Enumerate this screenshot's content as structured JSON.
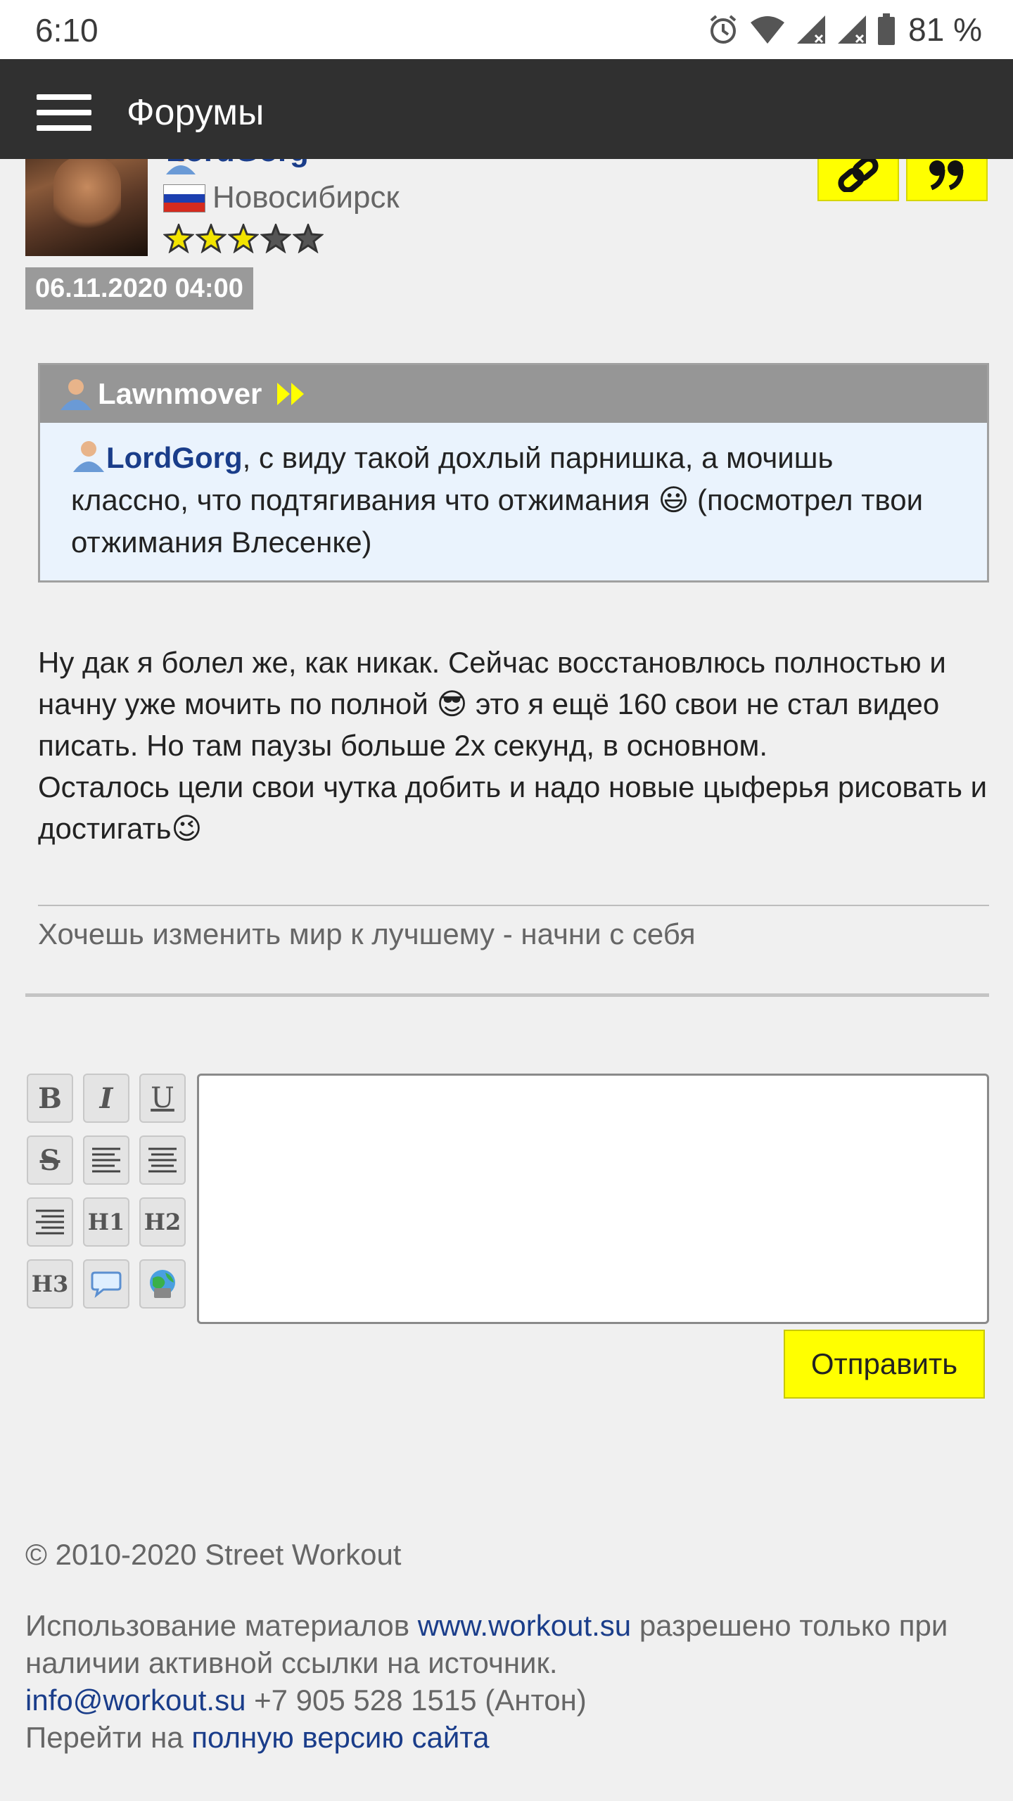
{
  "status_bar": {
    "time": "6:10",
    "battery": "81 %",
    "icons": [
      "alarm-icon",
      "wifi-icon",
      "signal-icon",
      "signal-icon",
      "battery-icon"
    ]
  },
  "app_bar": {
    "title": "Форумы",
    "menu_icon": "hamburger-menu-icon"
  },
  "post": {
    "author": "LordGorg",
    "city": "Новосибирск",
    "flag": "russia-flag",
    "rating": {
      "filled": 3,
      "total": 5
    },
    "date": "06.11.2020 04:00",
    "actions": [
      "link-icon",
      "quote-icon"
    ],
    "quote": {
      "author": "Lawnmover",
      "mention": "LordGorg",
      "text_1": ", с виду такой дохлый парнишка, а мочишь классно, что подтягивания что отжимания ",
      "emoji": "😃",
      "text_2": " (посмотрел твои отжимания Влесенке)"
    },
    "message": {
      "line_a": "Ну дак я болел же, как никак. Сейчас восстановлюсь полностью и начну уже мочить по полной ",
      "emoji_1": "😎",
      "line_b": " это я ещё 160 свои не стал видео писать. Но там паузы больше 2х секунд, в основном.",
      "line_c": "Осталось цели свои чутка добить и надо новые цыферья рисовать и достигать",
      "emoji_2": "😉"
    },
    "signature": "Хочешь изменить мир к лучшему - начни с себя"
  },
  "editor": {
    "buttons": [
      "B",
      "I",
      "U",
      "S",
      "align-left",
      "align-center",
      "align-right",
      "H1",
      "H2",
      "H3",
      "speech-bubble-icon",
      "globe-image-icon"
    ],
    "send_label": "Отправить",
    "value": ""
  },
  "footer": {
    "copyright": "© 2010-2020 Street Workout",
    "usage_pre": "Использование материалов ",
    "site_link": "www.workout.su",
    "usage_post": " разрешено только при наличии активной ссылки на источник.",
    "email": "info@workout.su",
    "phone": " +7 905 528 1515 (Антон)",
    "full_pre": "Перейти на ",
    "full_link": "полную версию сайта"
  },
  "colors": {
    "app_bar": "#303030",
    "accent_yellow": "#ffff00",
    "link_blue": "#1a3d8a",
    "quote_bg": "#eaf3fd",
    "quote_head": "#969696"
  }
}
